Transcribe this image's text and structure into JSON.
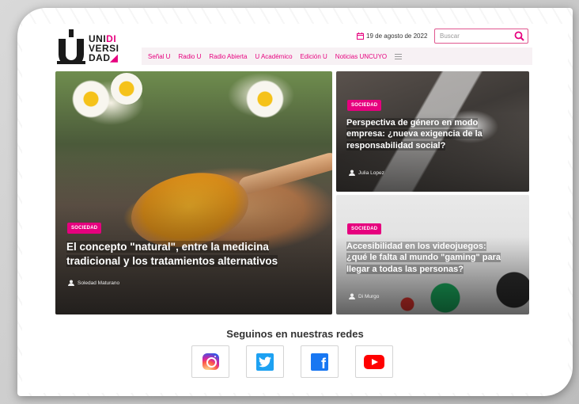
{
  "header": {
    "logo_text_lines": [
      "UNI",
      "DI",
      "VERSI",
      "DAD"
    ],
    "date": "19 de agosto de 2022",
    "search_placeholder": "Buscar"
  },
  "nav": {
    "items": [
      {
        "label": "Señal U"
      },
      {
        "label": "Radio U"
      },
      {
        "label": "Radio Abierta"
      },
      {
        "label": "U Académico"
      },
      {
        "label": "Edición U"
      },
      {
        "label": "Noticias UNCUYO"
      }
    ]
  },
  "articles": [
    {
      "category": "SOCIEDAD",
      "title_lines": [
        "El concepto \"natural\", entre la medicina",
        "tradicional y los tratamientos alternativos"
      ],
      "author": "Soledad Maturano"
    },
    {
      "category": "SOCIEDAD",
      "title_lines": [
        "Perspectiva de género en modo",
        "empresa: ¿nueva exigencia de la",
        "responsabilidad social?"
      ],
      "author": "Julia Lopez"
    },
    {
      "category": "SOCIEDAD",
      "title_lines": [
        "Accesibilidad en los videojuegos:",
        "¿qué le falta al mundo \"gaming\" para",
        "llegar a todas las personas?"
      ],
      "author": "Di Murgo"
    }
  ],
  "social": {
    "heading": "Seguinos en nuestras redes",
    "networks": [
      {
        "name": "instagram-icon"
      },
      {
        "name": "twitter-icon"
      },
      {
        "name": "facebook-icon"
      },
      {
        "name": "youtube-icon"
      }
    ]
  },
  "colors": {
    "accent": "#e6007e",
    "nav_bg": "#f7f1f4",
    "text_dark": "#1a1a1a"
  }
}
